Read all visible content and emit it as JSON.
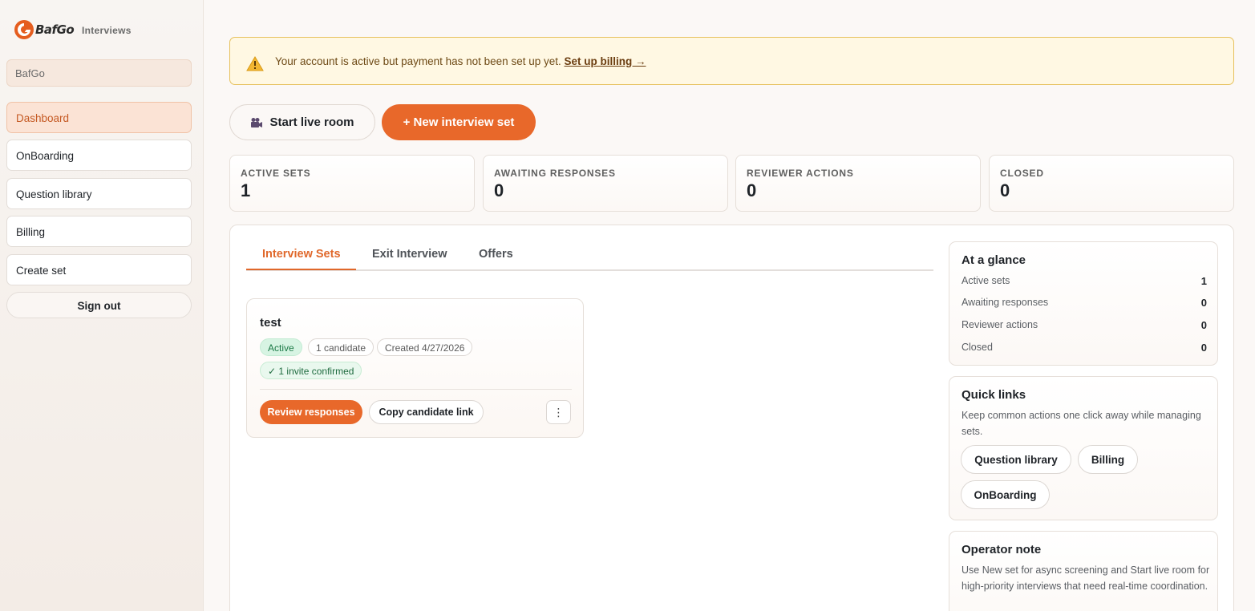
{
  "brand": {
    "name": "BafGo",
    "subtitle": "Interviews"
  },
  "sidebar": {
    "org": "BafGo",
    "items": [
      {
        "label": "Dashboard",
        "active": true
      },
      {
        "label": "OnBoarding"
      },
      {
        "label": "Question library"
      },
      {
        "label": "Billing"
      },
      {
        "label": "Create set"
      }
    ],
    "sign_out": "Sign out"
  },
  "banner": {
    "text": "Your account is active but payment has not been set up yet.",
    "link": "Set up billing →",
    "icon": "warning-icon"
  },
  "actions": {
    "live_room": "Start live room",
    "new_set": "+ New interview set"
  },
  "stats": [
    {
      "label": "ACTIVE SETS",
      "value": "1"
    },
    {
      "label": "AWAITING RESPONSES",
      "value": "0"
    },
    {
      "label": "REVIEWER ACTIONS",
      "value": "0"
    },
    {
      "label": "CLOSED",
      "value": "0"
    }
  ],
  "tabs": [
    {
      "label": "Interview Sets",
      "active": true
    },
    {
      "label": "Exit Interview"
    },
    {
      "label": "Offers"
    }
  ],
  "set_card": {
    "title": "test",
    "status": "Active",
    "candidates": "1 candidate",
    "created": "Created 4/27/2026",
    "confirmed": "✓ 1 invite confirmed",
    "review": "Review responses",
    "copy": "Copy candidate link",
    "more": "⋮"
  },
  "glance": {
    "title": "At a glance",
    "rows": [
      {
        "label": "Active sets",
        "value": "1"
      },
      {
        "label": "Awaiting responses",
        "value": "0"
      },
      {
        "label": "Reviewer actions",
        "value": "0"
      },
      {
        "label": "Closed",
        "value": "0"
      }
    ]
  },
  "quick_links": {
    "title": "Quick links",
    "desc": "Keep common actions one click away while managing sets.",
    "links": [
      "Question library",
      "Billing",
      "OnBoarding"
    ]
  },
  "operator_note": {
    "title": "Operator note",
    "desc": "Use New set for async screening and Start live room for high-priority interviews that need real-time coordination."
  },
  "colors": {
    "accent": "#e8682a",
    "banner_bg": "#fff8e3",
    "success": "#1d7a47"
  }
}
